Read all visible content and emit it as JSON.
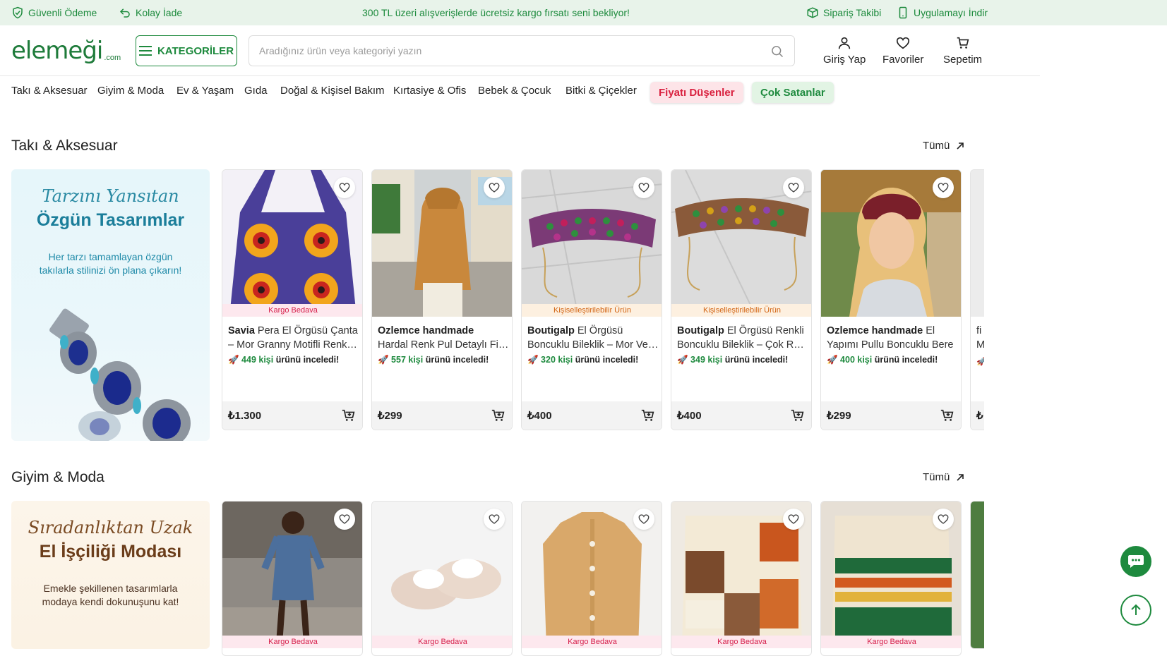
{
  "topbar": {
    "secure_payment": "Güvenli Ödeme",
    "easy_return": "Kolay İade",
    "promo": "300 TL üzeri alışverişlerde ücretsiz kargo fırsatı seni bekliyor!",
    "order_tracking": "Sipariş Takibi",
    "download_app": "Uygulamayı İndir"
  },
  "header": {
    "logo_main": "elemeği",
    "logo_sub": ".com",
    "categories_button": "KATEGORİLER",
    "search_placeholder": "Aradığınız ürün veya kategoriyi yazın",
    "login": "Giriş Yap",
    "favorites": "Favoriler",
    "cart": "Sepetim"
  },
  "nav": {
    "links": [
      "Takı & Aksesuar",
      "Giyim & Moda",
      "Ev & Yaşam",
      "Gıda",
      "Doğal & Kişisel Bakım",
      "Kırtasiye & Ofis",
      "Bebek & Çocuk",
      "Bitki & Çiçekler"
    ],
    "price_drop": "Fiyatı Düşenler",
    "best_sellers": "Çok Satanlar"
  },
  "sections": [
    {
      "title": "Takı & Aksesuar",
      "see_all": "Tümü",
      "banner": {
        "script": "Tarzını Yansıtan",
        "bold": "Özgün Tasarımlar",
        "desc": "Her tarzı tamamlayan özgün takılarla stilinizi ön plana çıkarın!"
      },
      "products": [
        {
          "tag": "Kargo Bedava",
          "shop": "Savia",
          "line1_rest": " Pera El Örgüsü Çanta",
          "line2": "– Mor Granny Motifli Renkli Çanta",
          "reviewers": "449 kişi",
          "review_suffix": " ürünü inceledi!",
          "price": "₺1.300"
        },
        {
          "tag": "",
          "shop": "Ozlemce handmade",
          "line1_rest": "",
          "line2": "Hardal Renk Pul Detaylı File Şapka",
          "reviewers": "557 kişi",
          "review_suffix": " ürünü inceledi!",
          "price": "₺299"
        },
        {
          "tag": "Kişiselleştirilebilir Ürün",
          "shop": "Boutigalp",
          "line1_rest": " El Örgüsü",
          "line2": "Boncuklu Bileklik – Mor Ve Yeşil",
          "reviewers": "320 kişi",
          "review_suffix": " ürünü inceledi!",
          "price": "₺400"
        },
        {
          "tag": "Kişiselleştirilebilir Ürün",
          "shop": "Boutigalp",
          "line1_rest": " El Örgüsü Renkli",
          "line2": "Boncuklu Bileklik – Çok Renkli",
          "reviewers": "349 kişi",
          "review_suffix": " ürünü inceledi!",
          "price": "₺400"
        },
        {
          "tag": "",
          "shop": "Ozlemce handmade",
          "line1_rest": " El",
          "line2": "Yapımı Pullu Boncuklu Bere",
          "reviewers": "400 kişi",
          "review_suffix": " ürünü inceledi!",
          "price": "₺299"
        }
      ],
      "peek_line1": "fi",
      "peek_line2": "M",
      "peek_price": "₺"
    },
    {
      "title": "Giyim & Moda",
      "see_all": "Tümü",
      "banner": {
        "script": "Sıradanlıktan Uzak",
        "bold": "El İşçiliği Modası",
        "desc": "Emekle şekillenen tasarımlarla modaya kendi dokunuşunu kat!"
      },
      "tags": [
        "Kargo Bedava",
        "Kargo Bedava",
        "Kargo Bedava",
        "Kargo Bedava",
        "Kargo Bedava"
      ]
    }
  ],
  "colors": {
    "brand_green": "#1e8a3e",
    "topbar_bg": "#e8f3ea",
    "free_shipping_pink": "#d6204c",
    "custom_orange": "#d26412"
  }
}
